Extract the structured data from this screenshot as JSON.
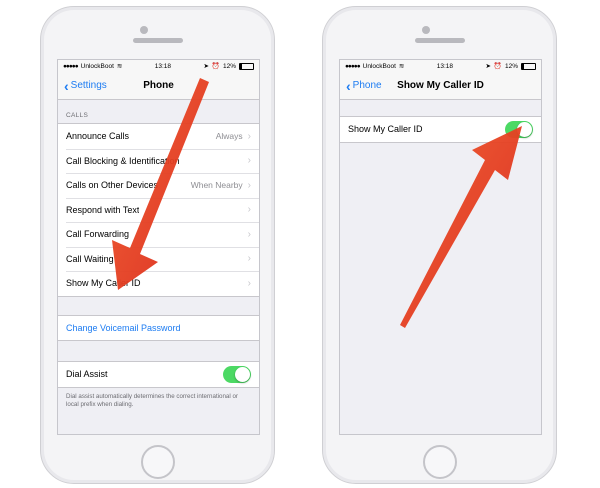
{
  "status": {
    "carrier": "UnlockBoot",
    "time": "13:18",
    "battery": "12%"
  },
  "left_screen": {
    "back_label": "Settings",
    "title": "Phone",
    "section_calls": "CALLS",
    "rows": [
      {
        "label": "Announce Calls",
        "value": "Always"
      },
      {
        "label": "Call Blocking & Identification",
        "value": ""
      },
      {
        "label": "Calls on Other Devices",
        "value": "When Nearby"
      },
      {
        "label": "Respond with Text",
        "value": ""
      },
      {
        "label": "Call Forwarding",
        "value": ""
      },
      {
        "label": "Call Waiting",
        "value": ""
      },
      {
        "label": "Show My Caller ID",
        "value": ""
      }
    ],
    "voicemail_link": "Change Voicemail Password",
    "dial_assist_label": "Dial Assist",
    "dial_assist_on": true,
    "dial_assist_note": "Dial assist automatically determines the correct international or local prefix when dialing."
  },
  "right_screen": {
    "back_label": "Phone",
    "title": "Show My Caller ID",
    "toggle_label": "Show My Caller ID",
    "toggle_on": true
  },
  "colors": {
    "accent": "#1d7cf2",
    "toggle_on": "#4cd964",
    "arrow": "#e8321b"
  }
}
